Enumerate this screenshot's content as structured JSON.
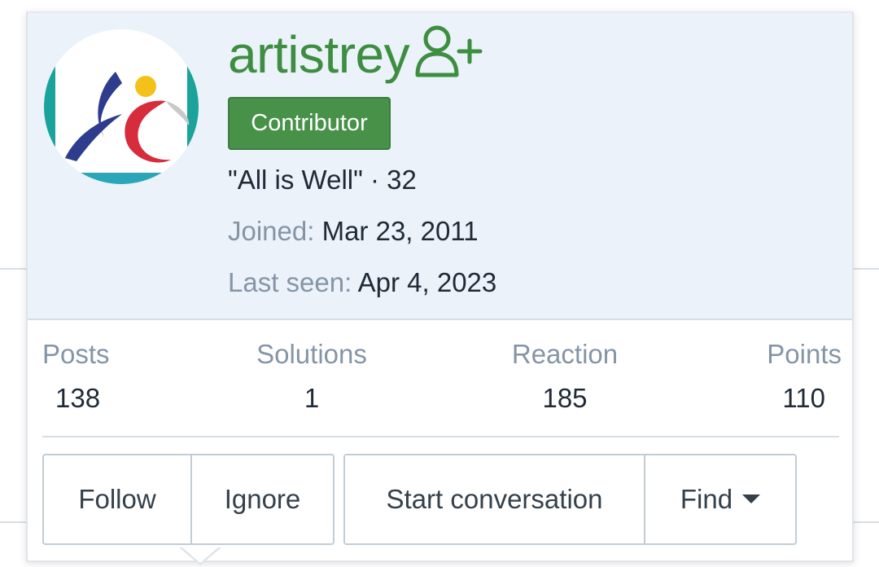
{
  "profile": {
    "username": "artistrey",
    "badge": "Contributor",
    "tagline": "\"All is Well\" · 32",
    "joined_label": "Joined:",
    "joined_value": "Mar 23, 2011",
    "last_seen_label": "Last seen:",
    "last_seen_value": "Apr 4, 2023"
  },
  "stats": [
    {
      "label": "Posts",
      "value": "138"
    },
    {
      "label": "Solutions",
      "value": "1"
    },
    {
      "label": "Reaction",
      "value": "185"
    },
    {
      "label": "Points",
      "value": "110"
    }
  ],
  "actions": {
    "follow": "Follow",
    "ignore": "Ignore",
    "start_conversation": "Start conversation",
    "find": "Find"
  },
  "icons": {
    "follow_user": "user-plus-icon",
    "find_caret": "caret-down-icon",
    "avatar": "avatar-logo"
  },
  "colors": {
    "username": "#3e8e41",
    "badge": "#479148",
    "header_bg": "#ebf2f9",
    "muted_label": "#8595a6",
    "text": "#1f2a36",
    "border": "#c2ccd6"
  }
}
